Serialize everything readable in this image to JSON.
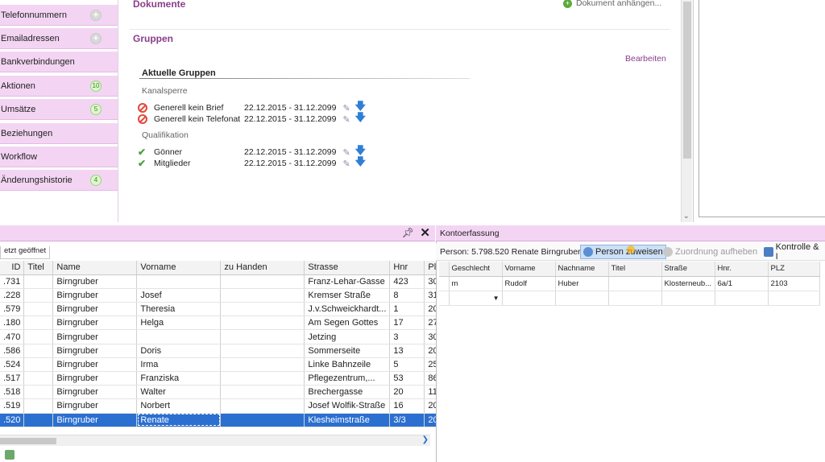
{
  "sidebar": {
    "items": [
      {
        "label": "Telefonnummern",
        "badge": "+",
        "badge_type": "plus"
      },
      {
        "label": "Emailadressen",
        "badge": "+",
        "badge_type": "plus"
      },
      {
        "label": "Bankverbindungen",
        "badge": "",
        "badge_type": "none"
      },
      {
        "label": "Aktionen",
        "badge": "10",
        "badge_type": "count"
      },
      {
        "label": "Umsätze",
        "badge": "5",
        "badge_type": "count"
      },
      {
        "label": "Beziehungen",
        "badge": "",
        "badge_type": "none"
      },
      {
        "label": "Workflow",
        "badge": "",
        "badge_type": "none"
      },
      {
        "label": "Änderungshistorie",
        "badge": "4",
        "badge_type": "count"
      }
    ]
  },
  "main": {
    "dokumente_title": "Dokumente",
    "dokument_link": "Dokument anhängen...",
    "gruppen_title": "Gruppen",
    "bearbeiten_link": "Bearbeiten",
    "aktuelle_gruppen": "Aktuelle Gruppen",
    "kanalsperre_label": "Kanalsperre",
    "kanalsperre_items": [
      {
        "name": "Generell kein Brief",
        "period": "22.12.2015 - 31.12.2099"
      },
      {
        "name": "Generell kein Telefonat",
        "period": "22.12.2015 - 31.12.2099"
      }
    ],
    "qualifikation_label": "Qualifikation",
    "qualifikation_items": [
      {
        "name": "Gönner",
        "period": "22.12.2015 - 31.12.2099"
      },
      {
        "name": "Mitglieder",
        "period": "22.12.2015 - 31.12.2099"
      }
    ]
  },
  "left_panel": {
    "tab_label": "etzt geöffnet",
    "columns": [
      "ID",
      "Titel",
      "Name",
      "Vorname",
      "zu Handen",
      "Strasse",
      "Hnr",
      "Pl"
    ],
    "rows": [
      {
        "id": ".731",
        "titel": "",
        "name": "Birngruber",
        "vorname": "",
        "zu_handen": "",
        "strasse": "Franz-Lehar-Gasse",
        "hnr": "423",
        "plz": "30"
      },
      {
        "id": ".228",
        "titel": "",
        "name": "Birngruber",
        "vorname": "Josef",
        "zu_handen": "",
        "strasse": "Kremser Straße",
        "hnr": "8",
        "plz": "31"
      },
      {
        "id": ".579",
        "titel": "",
        "name": "Birngruber",
        "vorname": "Theresia",
        "zu_handen": "",
        "strasse": "J.v.Schweickhardt...",
        "hnr": "1",
        "plz": "20"
      },
      {
        "id": ".180",
        "titel": "",
        "name": "Birngruber",
        "vorname": "Helga",
        "zu_handen": "",
        "strasse": "Am Segen Gottes",
        "hnr": "17",
        "plz": "27"
      },
      {
        "id": ".470",
        "titel": "",
        "name": "Birngruber",
        "vorname": "",
        "zu_handen": "",
        "strasse": "Jetzing",
        "hnr": "3",
        "plz": "30"
      },
      {
        "id": ".586",
        "titel": "",
        "name": "Birngruber",
        "vorname": "Doris",
        "zu_handen": "",
        "strasse": "Sommerseite",
        "hnr": "13",
        "plz": "20"
      },
      {
        "id": ".524",
        "titel": "",
        "name": "Birngruber",
        "vorname": "Irma",
        "zu_handen": "",
        "strasse": "Linke Bahnzeile",
        "hnr": "5",
        "plz": "25"
      },
      {
        "id": ".517",
        "titel": "",
        "name": "Birngruber",
        "vorname": "Franziska",
        "zu_handen": "",
        "strasse": "Pflegezentrum,...",
        "hnr": "53",
        "plz": "86"
      },
      {
        "id": ".518",
        "titel": "",
        "name": "Birngruber",
        "vorname": "Walter",
        "zu_handen": "",
        "strasse": "Brechergasse",
        "hnr": "20",
        "plz": "11"
      },
      {
        "id": ".519",
        "titel": "",
        "name": "Birngruber",
        "vorname": "Norbert",
        "zu_handen": "",
        "strasse": "Josef Wolfik-Straße",
        "hnr": "16",
        "plz": "20"
      },
      {
        "id": ".520",
        "titel": "",
        "name": "Birngruber",
        "vorname": "Renate",
        "zu_handen": "",
        "strasse": "Klesheimstraße",
        "hnr": "3/3",
        "plz": "20"
      }
    ]
  },
  "right_panel": {
    "title": "Kontoerfassung",
    "person_text": "Person:  5.798.520 Renate Birngruber",
    "btn_assign": "Person zuweisen",
    "btn_unassign": "Zuordnung aufheben",
    "btn_control": "Kontrolle & I",
    "columns": [
      "Geschlecht",
      "Vorname",
      "Nachname",
      "Titel",
      "Straße",
      "Hnr.",
      "PLZ"
    ],
    "row": {
      "geschlecht": "m",
      "vorname": "Rudolf",
      "nachname": "Huber",
      "titel": "",
      "strasse": "Klosterneub...",
      "hnr": "6a/1",
      "plz": "2103"
    }
  },
  "colors": {
    "accent": "#8a3d8a",
    "sidebar_bg": "#f3d5f3",
    "selection": "#2b6fd0"
  }
}
